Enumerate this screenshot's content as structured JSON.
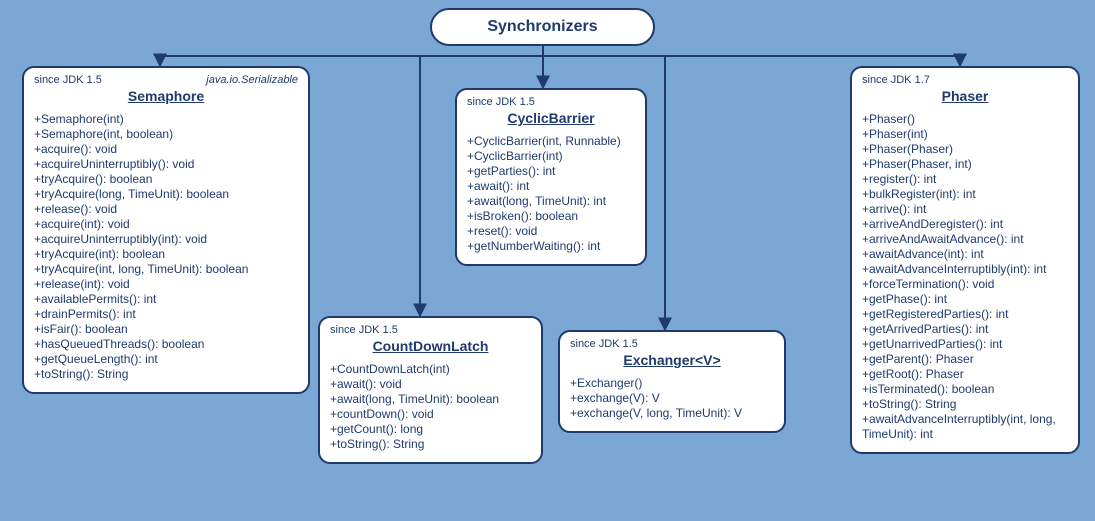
{
  "root": {
    "title": "Synchronizers"
  },
  "semaphore": {
    "since": "since JDK 1.5",
    "interface": "java.io.Serializable",
    "title": "Semaphore",
    "members": [
      "+Semaphore(int)",
      "+Semaphore(int, boolean)",
      "+acquire(): void",
      "+acquireUninterruptibly(): void",
      "+tryAcquire(): boolean",
      "+tryAcquire(long, TimeUnit): boolean",
      "+release(): void",
      "+acquire(int): void",
      "+acquireUninterruptibly(int): void",
      "+tryAcquire(int): boolean",
      "+tryAcquire(int, long, TimeUnit): boolean",
      "+release(int): void",
      "+availablePermits(): int",
      "+drainPermits(): int",
      "+isFair(): boolean",
      "+hasQueuedThreads(): boolean",
      "+getQueueLength(): int",
      "+toString(): String"
    ]
  },
  "cyclicbarrier": {
    "since": "since JDK 1.5",
    "title": "CyclicBarrier",
    "members": [
      "+CyclicBarrier(int, Runnable)",
      "+CyclicBarrier(int)",
      "+getParties(): int",
      "+await(): int",
      "+await(long, TimeUnit): int",
      "+isBroken(): boolean",
      "+reset(): void",
      "+getNumberWaiting(): int"
    ]
  },
  "countdownlatch": {
    "since": "since JDK 1.5",
    "title": "CountDownLatch",
    "members": [
      "+CountDownLatch(int)",
      "+await(): void",
      "+await(long, TimeUnit): boolean",
      "+countDown(): void",
      "+getCount(): long",
      "+toString(): String"
    ]
  },
  "exchanger": {
    "since": "since JDK 1.5",
    "title": "Exchanger<V>",
    "members": [
      "+Exchanger()",
      "+exchange(V): V",
      "+exchange(V, long, TimeUnit): V"
    ]
  },
  "phaser": {
    "since": "since JDK 1.7",
    "title": "Phaser",
    "members": [
      "+Phaser()",
      "+Phaser(int)",
      "+Phaser(Phaser)",
      "+Phaser(Phaser, int)",
      "+register(): int",
      "+bulkRegister(int): int",
      "+arrive(): int",
      "+arriveAndDeregister(): int",
      "+arriveAndAwaitAdvance(): int",
      "+awaitAdvance(int): int",
      "+awaitAdvanceInterruptibly(int): int",
      "+forceTermination(): void",
      "+getPhase(): int",
      "+getRegisteredParties(): int",
      "+getArrivedParties(): int",
      "+getUnarrivedParties(): int",
      "+getParent(): Phaser",
      "+getRoot(): Phaser",
      "+isTerminated(): boolean",
      "+toString(): String",
      "+awaitAdvanceInterruptibly(int, long, TimeUnit): int"
    ]
  }
}
